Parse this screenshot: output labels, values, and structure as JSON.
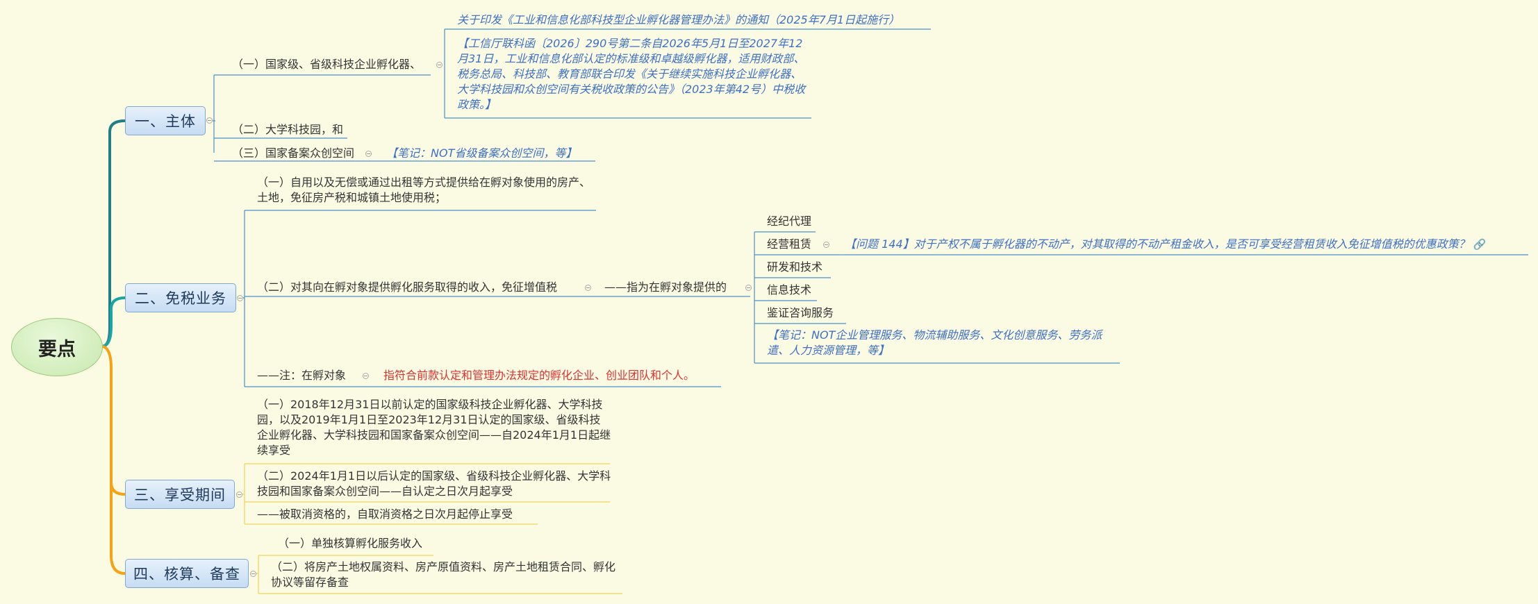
{
  "root": {
    "label": "要点"
  },
  "branches": {
    "subject": {
      "label": "一、主体",
      "items": [
        "（一）国家级、省级科技企业孵化器、",
        "（二）大学科技园，和",
        "（三）国家备案众创空间"
      ],
      "notice": "关于印发《工业和信息化部科技型企业孵化器管理办法》的通知（2025年7月1日起施行）",
      "policy": "【工信厅联科函〔2026〕290号第二条自2026年5月1日至2027年12月31日，工业和信息化部认定的标准级和卓越级孵化器，适用财政部、税务总局、科技部、教育部联合印发《关于继续实施科技企业孵化器、大学科技园和众创空间有关税收政策的公告》（2023年第42号）中税收政策。】",
      "note": "【笔记：NOT省级备案众创空间，等】"
    },
    "exempt": {
      "label": "二、免税业务",
      "item1": "（一）自用以及无偿或通过出租等方式提供给在孵对象使用的房产、土地，免征房产税和城镇土地使用税；",
      "item2": "（二）对其向在孵对象提供孵化服务取得的收入，免征增值税",
      "refers": "——指为在孵对象提供的",
      "services": [
        "经纪代理",
        "经营租赁",
        "研发和技术",
        "信息技术",
        "鉴证咨询服务"
      ],
      "question": "【问题 144】对于产权不属于孵化器的不动产，对其取得的不动产租金收入，是否可享受经营租赁收入免征增值税的优惠政策？",
      "services_note": "【笔记：NOT企业管理服务、物流辅助服务、文化创意服务、劳务派遣、人力资源管理，等】",
      "note_label": "——注：在孵对象",
      "note_text": "指符合前款认定和管理办法规定的孵化企业、创业团队和个人。"
    },
    "period": {
      "label": "三、享受期间",
      "items": [
        "（一）2018年12月31日以前认定的国家级科技企业孵化器、大学科技园，以及2019年1月1日至2023年12月31日认定的国家级、省级科技企业孵化器、大学科技园和国家备案众创空间——自2024年1月1日起继续享受",
        "（二）2024年1月1日以后认定的国家级、省级科技企业孵化器、大学科技园和国家备案众创空间——自认定之日次月起享受",
        "——被取消资格的，自取消资格之日次月起停止享受"
      ]
    },
    "accounting": {
      "label": "四、核算、备查",
      "items": [
        "（一）单独核算孵化服务收入",
        "（二）将房产土地权属资料、房产原值资料、房产土地租赁合同、孵化协议等留存备查"
      ]
    }
  },
  "colors": {
    "trunk_subject": "#1f7f86",
    "trunk_exempt": "#1aa5a5",
    "trunk_lower": "#f5a214",
    "line_blue": "#4a90c9",
    "line_yellow": "#f1d15a"
  },
  "icons": {
    "link": "link-icon"
  }
}
